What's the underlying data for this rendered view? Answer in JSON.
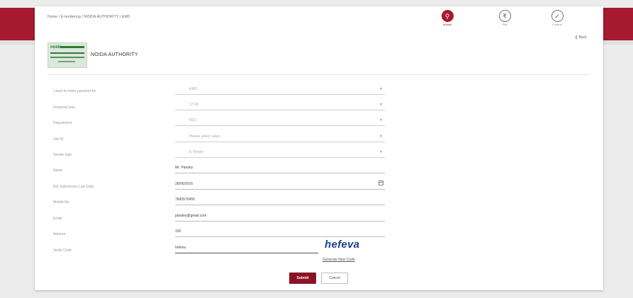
{
  "breadcrumb": "Home / E-tendering / NOIDA AUTHORITY / EMD",
  "steps": [
    {
      "label": "Submit",
      "icon": "search-icon",
      "glyph": "⚲"
    },
    {
      "label": "Pay",
      "icon": "rupee-icon",
      "glyph": "₹"
    },
    {
      "label": "Confirm",
      "icon": "check-icon",
      "glyph": "✓"
    }
  ],
  "back_label": "❮ Back",
  "org": {
    "logo_text": "noida",
    "name": "NOIDA AUTHORITY"
  },
  "form": {
    "fields": [
      {
        "label": "I want to make payment for",
        "value": "EMD",
        "type": "select"
      },
      {
        "label": "Financial year",
        "value": "17-18",
        "type": "select"
      },
      {
        "label": "Department",
        "value": "NCC",
        "type": "select"
      },
      {
        "label": "Job ID",
        "value": "Please select value",
        "type": "select"
      },
      {
        "label": "Tender type",
        "value": "E-Tender",
        "type": "select"
      },
      {
        "label": "Name",
        "value": "Mr. Pandey",
        "type": "text"
      },
      {
        "label": "Bid Submission Last Date",
        "value": "28/06/2016",
        "type": "date"
      },
      {
        "label": "Mobile No",
        "value": "7845570455",
        "type": "text"
      },
      {
        "label": "Email",
        "value": "pandey@gmail.com",
        "type": "text"
      },
      {
        "label": "Amount",
        "value": "150",
        "type": "text"
      }
    ],
    "captcha": {
      "label": "Verify Code",
      "value": "hefeva",
      "image_text": "hefeva",
      "regenerate_label": "Generate New Code"
    },
    "submit_label": "Submit",
    "cancel_label": "Cancel"
  },
  "colors": {
    "brand": "#a6192e",
    "submit": "#8b1424",
    "captcha": "#1d3f8f"
  }
}
